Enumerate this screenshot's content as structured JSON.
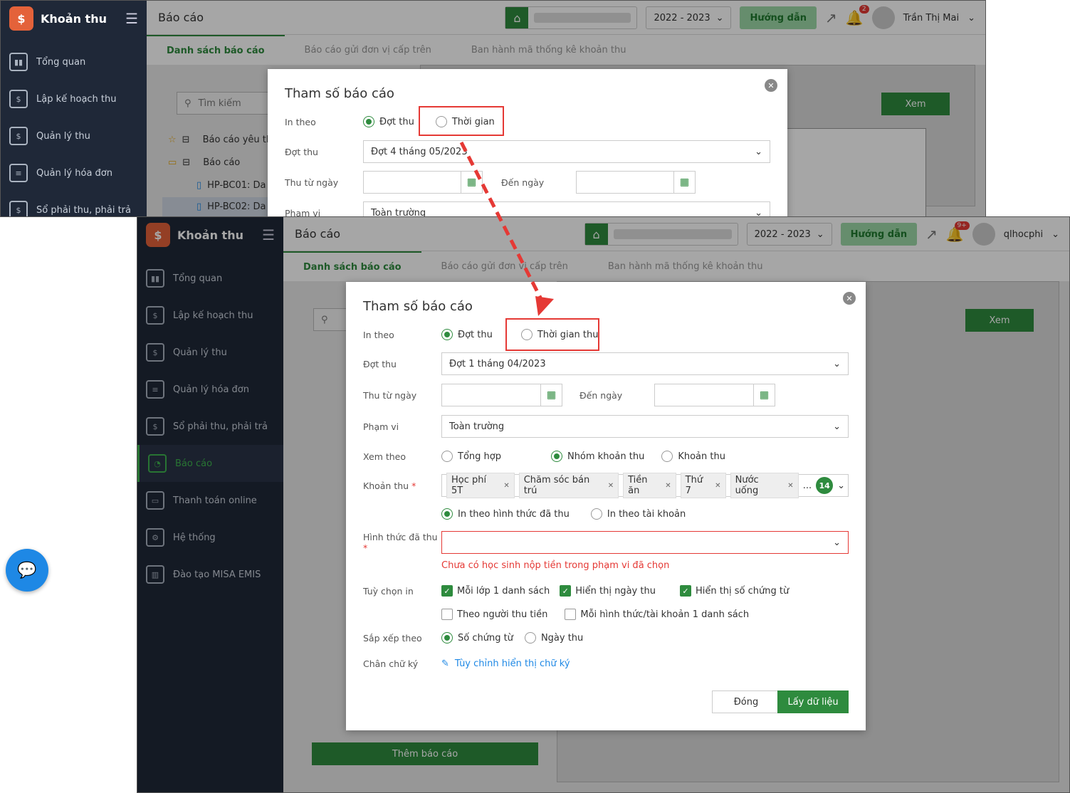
{
  "app_name": "Khoản thu",
  "sidebar": {
    "items": [
      {
        "label": "Tổng quan",
        "icon": "chart-bars-icon"
      },
      {
        "label": "Lập kế hoạch thu",
        "icon": "calendar-money-icon"
      },
      {
        "label": "Quản lý thu",
        "icon": "hand-coin-icon"
      },
      {
        "label": "Quản lý hóa đơn",
        "icon": "invoice-icon"
      },
      {
        "label": "Sổ phải thu, phải trả",
        "icon": "ledger-icon"
      },
      {
        "label": "Báo cáo",
        "icon": "pie-chart-icon"
      },
      {
        "label": "Thanh toán online",
        "icon": "card-check-icon"
      },
      {
        "label": "Hệ thống",
        "icon": "gear-icon"
      },
      {
        "label": "Đào tạo MISA EMIS",
        "icon": "book-icon"
      }
    ]
  },
  "header": {
    "title": "Báo cáo",
    "year": "2022 - 2023",
    "guide": "Hướng dẫn",
    "user_a": "Trần Thị Mai",
    "user_b": "qlhocphi",
    "notif_a": "2",
    "notif_b": "9+"
  },
  "tabs": [
    "Danh sách báo cáo",
    "Báo cáo gửi đơn vị cấp trên",
    "Ban hành mã thống kê khoản thu"
  ],
  "left": {
    "search_placeholder": "Tìm kiếm",
    "tree": [
      "Báo cáo yêu thích",
      "Báo cáo",
      "HP-BC01: Da",
      "HP-BC02: Da"
    ],
    "add_button": "Thêm báo cáo"
  },
  "view_button": "Xem",
  "modal_a": {
    "title": "Tham số báo cáo",
    "in_theo_label": "In theo",
    "opt_dot_thu": "Đợt thu",
    "opt_thoi_gian": "Thời gian",
    "dot_thu_label": "Đợt thu",
    "dot_thu_value": "Đợt 4 tháng 05/2023",
    "from_label": "Thu từ ngày",
    "to_label": "Đến ngày",
    "pham_vi_label": "Phạm vi",
    "pham_vi_value": "Toàn trường"
  },
  "modal_b": {
    "title": "Tham số báo cáo",
    "in_theo_label": "In theo",
    "opt_dot_thu": "Đợt thu",
    "opt_thoi_gian": "Thời gian thu",
    "dot_thu_label": "Đợt thu",
    "dot_thu_value": "Đợt 1 tháng 04/2023",
    "from_label": "Thu từ ngày",
    "to_label": "Đến ngày",
    "pham_vi_label": "Phạm vi",
    "pham_vi_value": "Toàn trường",
    "xem_theo_label": "Xem theo",
    "xem_theo_opts": [
      "Tổng hợp",
      "Nhóm khoản thu",
      "Khoản thu"
    ],
    "khoan_thu_label": "Khoản thu",
    "khoan_thu_tags": [
      "Học phí 5T",
      "Chăm sóc bán trú",
      "Tiền ăn",
      "Thứ 7",
      "Nước uống"
    ],
    "khoan_thu_more": "...",
    "khoan_thu_count": "14",
    "in_theo_opts": [
      "In theo hình thức đã thu",
      "In theo tài khoản"
    ],
    "hinh_thuc_label": "Hình thức đã thu",
    "error_text": "Chưa có học sinh nộp tiền trong phạm vi đã chọn",
    "tuy_chon_label": "Tuỳ chọn in",
    "options": [
      {
        "label": "Mỗi lớp 1 danh sách",
        "checked": true
      },
      {
        "label": "Hiển thị ngày thu",
        "checked": true
      },
      {
        "label": "Hiển thị số chứng từ",
        "checked": true
      },
      {
        "label": "Theo người thu tiền",
        "checked": false
      },
      {
        "label": "Mỗi hình thức/tài khoản 1 danh sách",
        "checked": false
      }
    ],
    "sap_xep_label": "Sắp xếp theo",
    "sap_xep_opts": [
      "Số chứng từ",
      "Ngày thu"
    ],
    "chan_chu_ky_label": "Chân chữ ký",
    "chan_chu_ky_link": "Tùy chỉnh hiển thị chữ ký",
    "close_button": "Đóng",
    "submit_button": "Lấy dữ liệu"
  },
  "colors": {
    "brand_green": "#2e8b3e",
    "sidebar_bg": "#1f2838",
    "highlight_red": "#e53935",
    "accent_orange": "#e4623a"
  }
}
